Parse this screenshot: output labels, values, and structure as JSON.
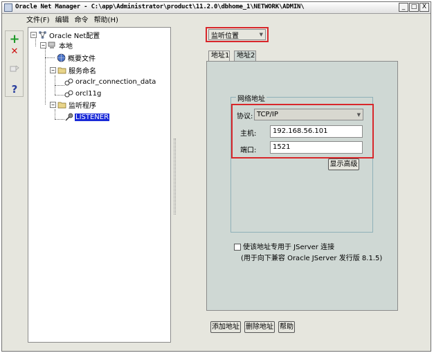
{
  "window": {
    "title": "Oracle Net Manager - C:\\app\\Administrator\\product\\11.2.0\\dbhome_1\\NETWORK\\ADMIN\\",
    "controls": [
      "_",
      "□",
      "X"
    ]
  },
  "menubar": {
    "items": [
      "文件(F)",
      "编辑",
      "命令",
      "帮助(H)"
    ]
  },
  "toolbar": {
    "add": "+",
    "remove": "✕",
    "help": "?"
  },
  "tree": {
    "root": "Oracle Net配置",
    "local": "本地",
    "profile": "概要文件",
    "naming": "服务命名",
    "service1": "oraclr_connection_data",
    "service2": "orcl11g",
    "listeners": "监听程序",
    "listener": "LISTENER"
  },
  "view_select": {
    "value": "监听位置"
  },
  "tabs": [
    "地址1",
    "地址2"
  ],
  "address": {
    "group_title": "网络地址",
    "protocol_label": "协议:",
    "protocol_value": "TCP/IP",
    "host_label": "主机:",
    "host_value": "192.168.56.101",
    "port_label": "端口:",
    "port_value": "1521",
    "advanced_button": "显示高级"
  },
  "jserver": {
    "label": "使该地址专用于 JServer 连接",
    "note": "(用于向下兼容 Oracle JServer 发行版 8.1.5)"
  },
  "actions": {
    "add_address": "添加地址",
    "remove_address": "删除地址",
    "help": "帮助"
  },
  "colors": {
    "highlight": "#d8262a",
    "selection": "#1a2ad8",
    "add_icon": "#1f9a2a",
    "remove_icon": "#cc1111",
    "help_icon": "#2a3f9e"
  }
}
